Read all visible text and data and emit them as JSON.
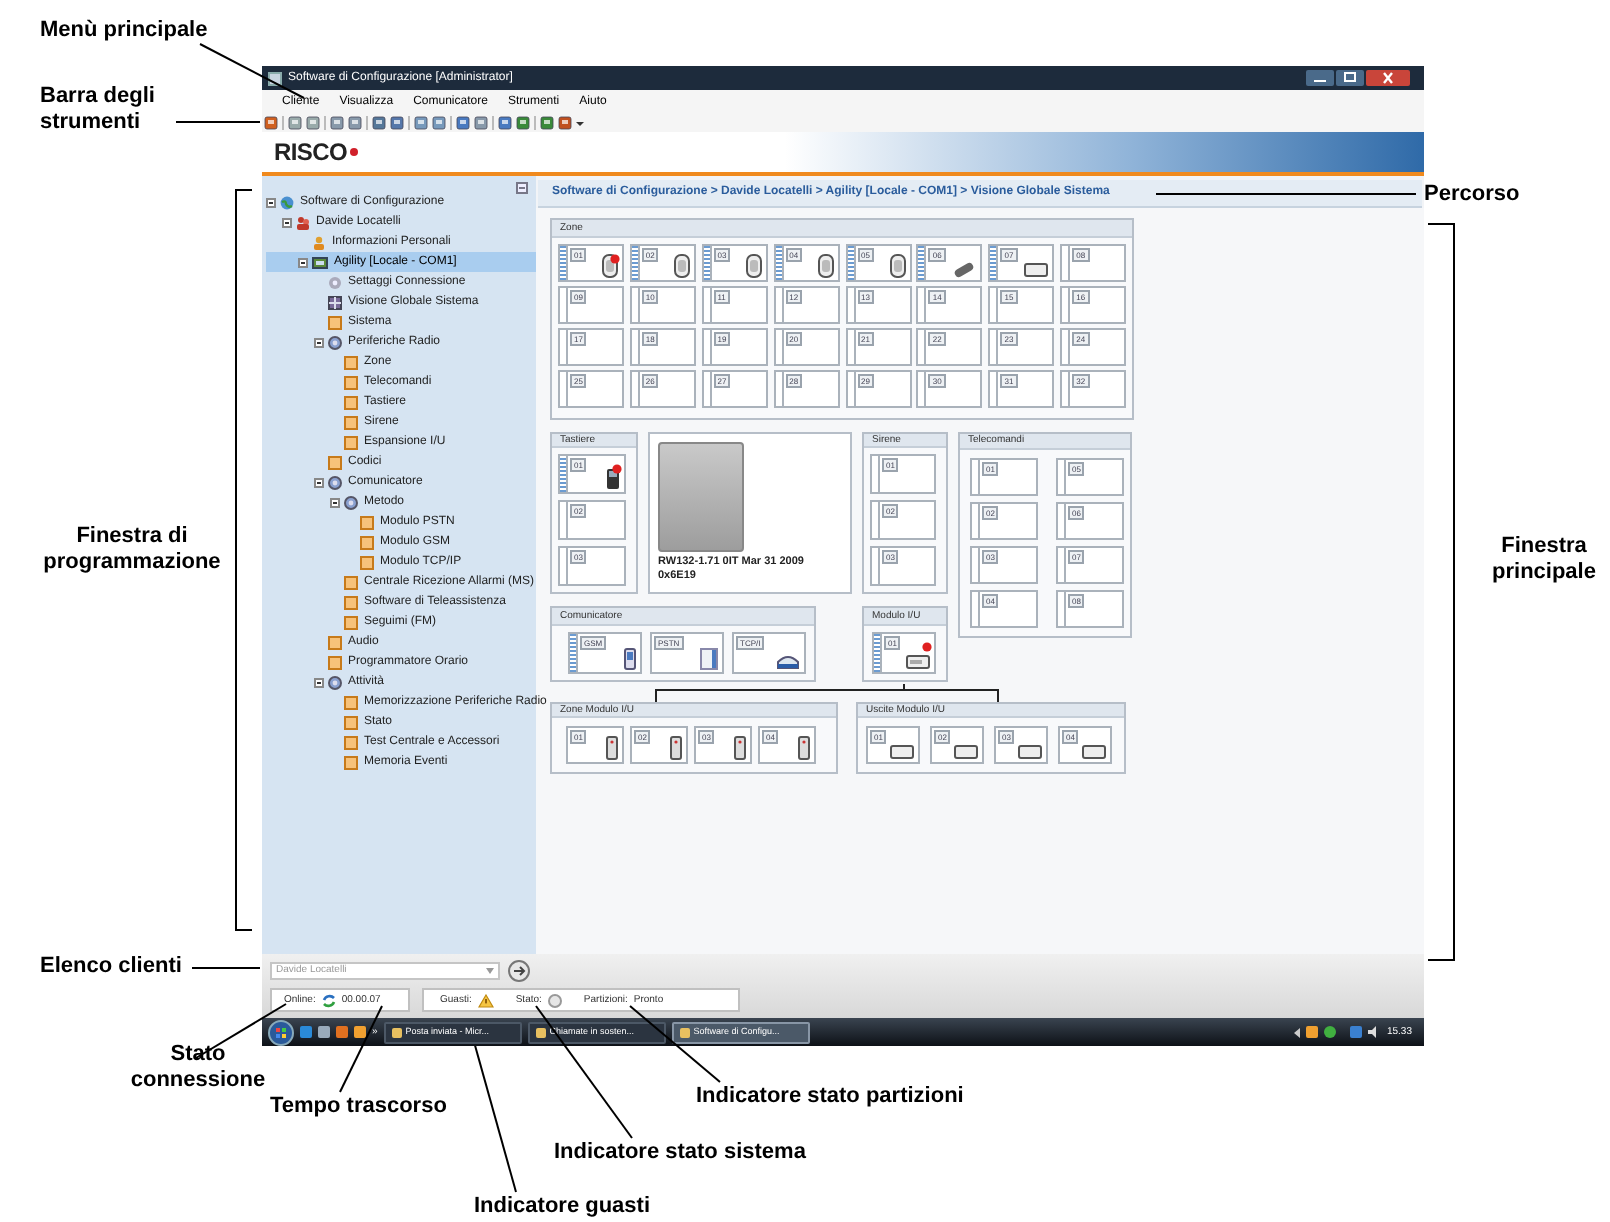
{
  "window": {
    "title": "Software di Configurazione [Administrator]"
  },
  "menu": [
    "Cliente",
    "Visualizza",
    "Comunicatore",
    "Strumenti",
    "Aiuto"
  ],
  "logo": "RISCO",
  "tree": [
    {
      "label": "Software di Configurazione",
      "kind": "globe",
      "selected": false,
      "children": [
        {
          "label": "Davide Locatelli",
          "kind": "user",
          "selected": false,
          "children": [
            {
              "label": "Informazioni Personali",
              "kind": "person",
              "selected": false
            },
            {
              "label": "Agility [Locale - COM1]",
              "kind": "device",
              "selected": true,
              "children": [
                {
                  "label": "Settaggi Connessione",
                  "kind": "gear",
                  "selected": false
                },
                {
                  "label": "Visione Globale Sistema",
                  "kind": "view",
                  "selected": false
                },
                {
                  "label": "Sistema",
                  "kind": "page",
                  "selected": false
                },
                {
                  "label": "Periferiche Radio",
                  "kind": "group",
                  "selected": false,
                  "children": [
                    {
                      "label": "Zone",
                      "kind": "page",
                      "selected": false
                    },
                    {
                      "label": "Telecomandi",
                      "kind": "page",
                      "selected": false
                    },
                    {
                      "label": "Tastiere",
                      "kind": "page",
                      "selected": false
                    },
                    {
                      "label": "Sirene",
                      "kind": "page",
                      "selected": false
                    },
                    {
                      "label": "Espansione I/U",
                      "kind": "page",
                      "selected": false
                    }
                  ]
                },
                {
                  "label": "Codici",
                  "kind": "page",
                  "selected": false
                },
                {
                  "label": "Comunicatore",
                  "kind": "group",
                  "selected": false,
                  "children": [
                    {
                      "label": "Metodo",
                      "kind": "group",
                      "selected": false,
                      "children": [
                        {
                          "label": "Modulo PSTN",
                          "kind": "page",
                          "selected": false
                        },
                        {
                          "label": "Modulo GSM",
                          "kind": "page",
                          "selected": false
                        },
                        {
                          "label": "Modulo TCP/IP",
                          "kind": "page",
                          "selected": false
                        }
                      ]
                    },
                    {
                      "label": "Centrale Ricezione Allarmi (MS)",
                      "kind": "page",
                      "selected": false
                    },
                    {
                      "label": "Software di Teleassistenza",
                      "kind": "page",
                      "selected": false
                    },
                    {
                      "label": "Seguimi (FM)",
                      "kind": "page",
                      "selected": false
                    }
                  ]
                },
                {
                  "label": "Audio",
                  "kind": "page",
                  "selected": false
                },
                {
                  "label": "Programmatore Orario",
                  "kind": "page",
                  "selected": false
                },
                {
                  "label": "Attività",
                  "kind": "group",
                  "selected": false,
                  "children": [
                    {
                      "label": "Memorizzazione Periferiche Radio",
                      "kind": "page",
                      "selected": false
                    },
                    {
                      "label": "Stato",
                      "kind": "page",
                      "selected": false
                    },
                    {
                      "label": "Test Centrale e Accessori",
                      "kind": "page",
                      "selected": false
                    },
                    {
                      "label": "Memoria Eventi",
                      "kind": "page",
                      "selected": false
                    }
                  ]
                }
              ]
            }
          ]
        }
      ]
    }
  ],
  "breadcrumb": "Software di Configurazione > Davide Locatelli > Agility [Locale - COM1] > Visione Globale Sistema",
  "zones": {
    "title": "Zone",
    "slots": [
      {
        "label": "01",
        "kind": "pir",
        "alarm": true
      },
      {
        "label": "02",
        "kind": "pir",
        "alarm": false
      },
      {
        "label": "03",
        "kind": "pir",
        "alarm": false
      },
      {
        "label": "04",
        "kind": "pir",
        "alarm": false
      },
      {
        "label": "05",
        "kind": "pir",
        "alarm": false
      },
      {
        "label": "06",
        "kind": "contact",
        "alarm": false
      },
      {
        "label": "07",
        "kind": "box",
        "alarm": false
      },
      {
        "label": "08",
        "kind": "empty",
        "alarm": false
      },
      {
        "label": "09",
        "kind": "empty",
        "alarm": false
      },
      {
        "label": "10",
        "kind": "empty",
        "alarm": false
      },
      {
        "label": "11",
        "kind": "empty",
        "alarm": false
      },
      {
        "label": "12",
        "kind": "empty",
        "alarm": false
      },
      {
        "label": "13",
        "kind": "empty",
        "alarm": false
      },
      {
        "label": "14",
        "kind": "empty",
        "alarm": false
      },
      {
        "label": "15",
        "kind": "empty",
        "alarm": false
      },
      {
        "label": "16",
        "kind": "empty",
        "alarm": false
      },
      {
        "label": "17",
        "kind": "empty",
        "alarm": false
      },
      {
        "label": "18",
        "kind": "empty",
        "alarm": false
      },
      {
        "label": "19",
        "kind": "empty",
        "alarm": false
      },
      {
        "label": "20",
        "kind": "empty",
        "alarm": false
      },
      {
        "label": "21",
        "kind": "empty",
        "alarm": false
      },
      {
        "label": "22",
        "kind": "empty",
        "alarm": false
      },
      {
        "label": "23",
        "kind": "empty",
        "alarm": false
      },
      {
        "label": "24",
        "kind": "empty",
        "alarm": false
      },
      {
        "label": "25",
        "kind": "empty",
        "alarm": false
      },
      {
        "label": "26",
        "kind": "empty",
        "alarm": false
      },
      {
        "label": "27",
        "kind": "empty",
        "alarm": false
      },
      {
        "label": "28",
        "kind": "empty",
        "alarm": false
      },
      {
        "label": "29",
        "kind": "empty",
        "alarm": false
      },
      {
        "label": "30",
        "kind": "empty",
        "alarm": false
      },
      {
        "label": "31",
        "kind": "empty",
        "alarm": false
      },
      {
        "label": "32",
        "kind": "empty",
        "alarm": false
      }
    ]
  },
  "keypads": {
    "title": "Tastiere",
    "slots": [
      {
        "label": "01",
        "kind": "keypad",
        "alarm": true
      },
      {
        "label": "02",
        "kind": "empty",
        "alarm": false
      },
      {
        "label": "03",
        "kind": "empty",
        "alarm": false
      }
    ]
  },
  "panel": {
    "caption": "RW132-1.71 0IT Mar 31 2009 0x6E19"
  },
  "sirens": {
    "title": "Sirene",
    "slots": [
      {
        "label": "01",
        "kind": "empty",
        "alarm": false
      },
      {
        "label": "02",
        "kind": "empty",
        "alarm": false
      },
      {
        "label": "03",
        "kind": "empty",
        "alarm": false
      }
    ]
  },
  "remotes": {
    "title": "Telecomandi",
    "slots": [
      {
        "label": "01",
        "kind": "empty",
        "alarm": false
      },
      {
        "label": "02",
        "kind": "empty",
        "alarm": false
      },
      {
        "label": "03",
        "kind": "empty",
        "alarm": false
      },
      {
        "label": "04",
        "kind": "empty",
        "alarm": false
      },
      {
        "label": "05",
        "kind": "empty",
        "alarm": false
      },
      {
        "label": "06",
        "kind": "empty",
        "alarm": false
      },
      {
        "label": "07",
        "kind": "empty",
        "alarm": false
      },
      {
        "label": "08",
        "kind": "empty",
        "alarm": false
      }
    ]
  },
  "communicator": {
    "title": "Comunicatore",
    "slots": [
      {
        "label": "GSM",
        "kind": "gsm",
        "alarm": false
      },
      {
        "label": "PSTN",
        "kind": "pstn",
        "alarm": false
      },
      {
        "label": "TCP/I",
        "kind": "tcpip",
        "alarm": false
      }
    ]
  },
  "io_module": {
    "title": "Modulo I/U",
    "slots": [
      {
        "label": "01",
        "kind": "iobox",
        "alarm": true
      }
    ]
  },
  "io_zones": {
    "title": "Zone Modulo I/U",
    "slots": [
      {
        "label": "01",
        "kind": "door",
        "alarm": false
      },
      {
        "label": "02",
        "kind": "door",
        "alarm": false
      },
      {
        "label": "03",
        "kind": "door",
        "alarm": false
      },
      {
        "label": "04",
        "kind": "door",
        "alarm": false
      }
    ]
  },
  "io_outputs": {
    "title": "Uscite Modulo I/U",
    "slots": [
      {
        "label": "01",
        "kind": "box",
        "alarm": false
      },
      {
        "label": "02",
        "kind": "box",
        "alarm": false
      },
      {
        "label": "03",
        "kind": "box",
        "alarm": false
      },
      {
        "label": "04",
        "kind": "box",
        "alarm": false
      }
    ]
  },
  "client_list": {
    "value": "Davide Locatelli"
  },
  "status_bar": {
    "online_label": "Online:",
    "elapsed": "00.00.07",
    "faults_label": "Guasti:",
    "state_label": "Stato:",
    "partitions_label": "Partizioni:",
    "partitions_value": "Pronto"
  },
  "taskbar": {
    "more": "»",
    "tasks": [
      {
        "label": "Posta inviata - Micr...",
        "selected": false
      },
      {
        "label": "Chiamate in sosten...",
        "selected": false
      },
      {
        "label": "Software di Configu...",
        "selected": true
      }
    ],
    "clock": "15.33"
  },
  "callouts": [
    {
      "text": "Menù principale"
    },
    {
      "text": "Barra degli strumenti"
    },
    {
      "text": "Percorso"
    },
    {
      "text": "Finestra di programmazione"
    },
    {
      "text": "Finestra principale"
    },
    {
      "text": "Elenco clienti"
    },
    {
      "text": "Stato connessione"
    },
    {
      "text": "Tempo trascorso"
    },
    {
      "text": "Indicatore stato partizioni"
    },
    {
      "text": "Indicatore stato sistema"
    },
    {
      "text": "Indicatore guasti"
    }
  ]
}
